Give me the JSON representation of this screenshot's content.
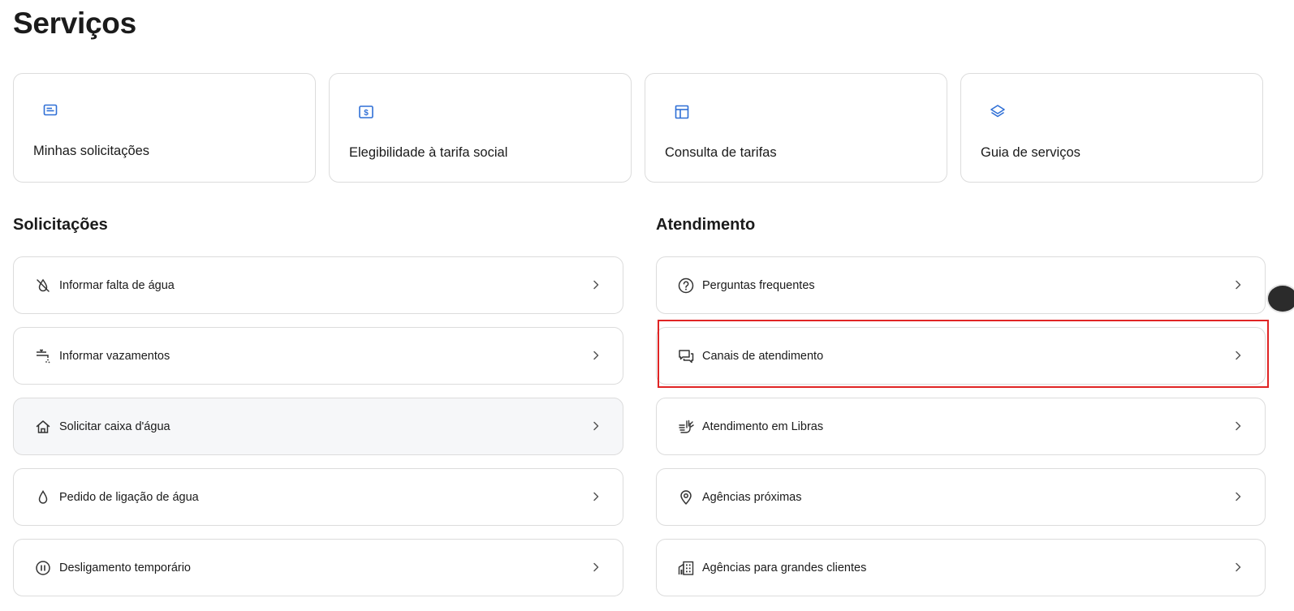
{
  "page": {
    "title": "Serviços"
  },
  "cards": [
    {
      "label": "Minhas solicitações",
      "icon": "id-card-icon"
    },
    {
      "label": "Elegibilidade à tarifa social",
      "icon": "money-bill-icon"
    },
    {
      "label": "Consulta de tarifas",
      "icon": "table-layout-icon"
    },
    {
      "label": "Guia de serviços",
      "icon": "layers-icon"
    }
  ],
  "solicitacoes": {
    "title": "Solicitações",
    "items": [
      {
        "label": "Informar falta de água",
        "icon": "water-drop-off-icon"
      },
      {
        "label": "Informar vazamentos",
        "icon": "faucet-leak-icon"
      },
      {
        "label": "Solicitar caixa d'água",
        "icon": "house-icon"
      },
      {
        "label": "Pedido de ligação de água",
        "icon": "water-drop-icon"
      },
      {
        "label": "Desligamento temporário",
        "icon": "pause-circle-icon"
      }
    ]
  },
  "atendimento": {
    "title": "Atendimento",
    "items": [
      {
        "label": "Perguntas frequentes",
        "icon": "question-circle-icon"
      },
      {
        "label": "Canais de atendimento",
        "icon": "chat-bubbles-icon"
      },
      {
        "label": "Atendimento em Libras",
        "icon": "sign-language-hands-icon"
      },
      {
        "label": "Agências próximas",
        "icon": "map-pin-icon"
      },
      {
        "label": "Agências para grandes clientes",
        "icon": "buildings-icon"
      }
    ]
  },
  "colors": {
    "accent_icon": "#2f6fd6",
    "border": "#dcdcdc",
    "text": "#1a1a1a",
    "highlight": "#e02424",
    "hover_row": "#f6f7f9"
  }
}
